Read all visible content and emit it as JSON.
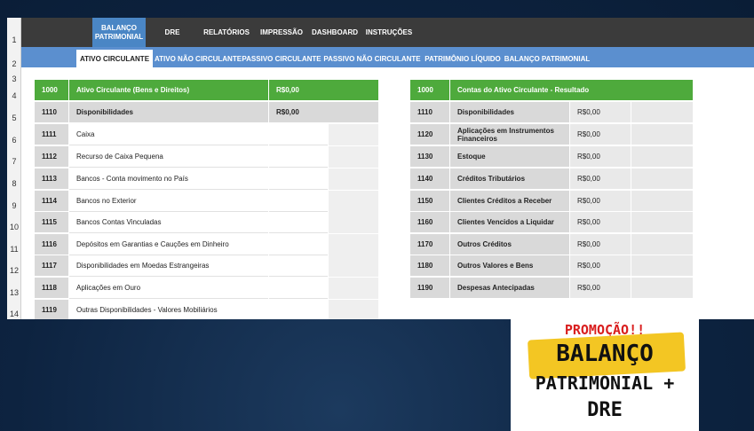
{
  "menu": {
    "items": [
      {
        "label_line1": "BALANÇO",
        "label_line2": "PATRIMONIAL",
        "active": true
      },
      {
        "label_line1": "DRE",
        "label_line2": ""
      },
      {
        "label_line1": "RELATÓRIOS",
        "label_line2": ""
      },
      {
        "label_line1": "IMPRESSÃO",
        "label_line2": ""
      },
      {
        "label_line1": "DASHBOARD",
        "label_line2": ""
      },
      {
        "label_line1": "INSTRUÇÕES",
        "label_line2": ""
      }
    ]
  },
  "submenu": {
    "items": [
      {
        "label": "ATIVO CIRCULANTE",
        "active": true
      },
      {
        "label": "ATIVO NÃO CIRCULANTE"
      },
      {
        "label": "PASSIVO CIRCULANTE"
      },
      {
        "label": "PASSIVO NÃO CIRCULANTE"
      },
      {
        "label": "PATRIMÔNIO LÍQUIDO"
      },
      {
        "label": "BALANÇO PATRIMONIAL"
      }
    ]
  },
  "row_numbers": [
    "1",
    "2",
    "3",
    "4",
    "5",
    "6",
    "7",
    "8",
    "9",
    "10",
    "11",
    "12",
    "13",
    "14"
  ],
  "left_table": {
    "header": {
      "code": "1000",
      "name": "Ativo Circulante (Bens e Direitos)",
      "value": "R$0,00"
    },
    "subheader": {
      "code": "1110",
      "name": "Disponibilidades",
      "value": "R$0,00"
    },
    "rows": [
      {
        "code": "1111",
        "name": "Caixa"
      },
      {
        "code": "1112",
        "name": "Recurso de Caixa Pequena"
      },
      {
        "code": "1113",
        "name": "Bancos - Conta movimento no País"
      },
      {
        "code": "1114",
        "name": "Bancos no Exterior"
      },
      {
        "code": "1115",
        "name": "Bancos Contas Vinculadas"
      },
      {
        "code": "1116",
        "name": "Depósitos em Garantias e Cauções em Dinheiro"
      },
      {
        "code": "1117",
        "name": "Disponibilidades em Moedas Estrangeiras"
      },
      {
        "code": "1118",
        "name": "Aplicações em Ouro"
      },
      {
        "code": "1119",
        "name": "Outras Disponibilidades - Valores Mobiliários"
      }
    ]
  },
  "right_table": {
    "header": {
      "code": "1000",
      "name": "Contas do Ativo Circulante - Resultado"
    },
    "rows": [
      {
        "code": "1110",
        "name": "Disponibilidades",
        "value": "R$0,00"
      },
      {
        "code": "1120",
        "name": "Aplicações em Instrumentos Financeiros",
        "value": "R$0,00"
      },
      {
        "code": "1130",
        "name": "Estoque",
        "value": "R$0,00"
      },
      {
        "code": "1140",
        "name": "Créditos Tributários",
        "value": "R$0,00"
      },
      {
        "code": "1150",
        "name": "Clientes Créditos a Receber",
        "value": "R$0,00"
      },
      {
        "code": "1160",
        "name": "Clientes Vencidos a Liquidar",
        "value": "R$0,00"
      },
      {
        "code": "1170",
        "name": "Outros Créditos",
        "value": "R$0,00"
      },
      {
        "code": "1180",
        "name": "Outros Valores e Bens",
        "value": "R$0,00"
      },
      {
        "code": "1190",
        "name": "Despesas Antecipadas",
        "value": "R$0,00"
      }
    ]
  },
  "promo": {
    "title": "PROMOÇÃO!!",
    "line1": "BALANÇO",
    "line2": "PATRIMONIAL +",
    "line3": "DRE"
  },
  "colors": {
    "header_green": "#4eaa3c",
    "menu_dark": "#3b3b3b",
    "submenu_blue": "#5b8fcf",
    "promo_red": "#d91e1e",
    "promo_yellow": "#f3c623"
  }
}
